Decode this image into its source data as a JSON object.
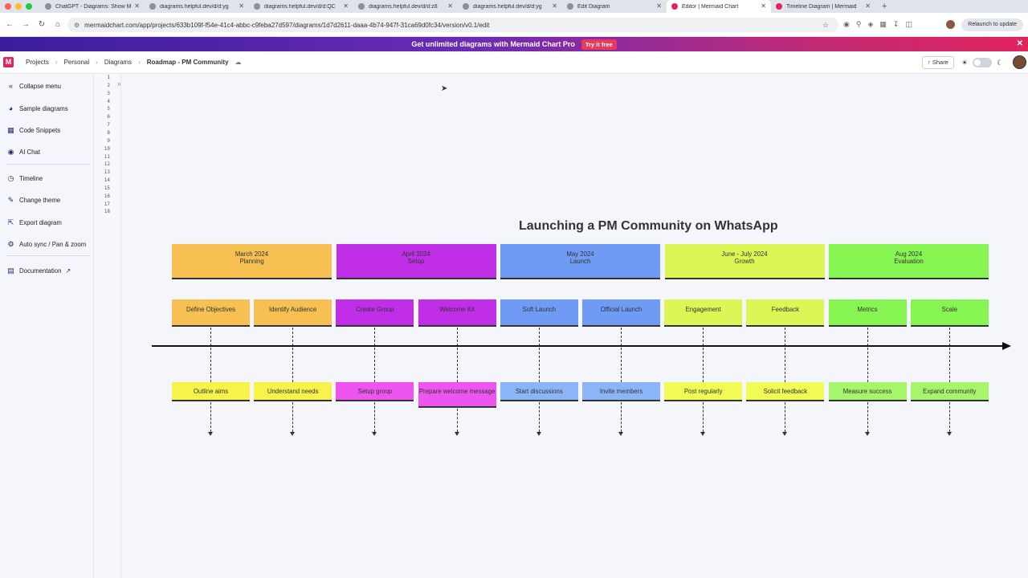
{
  "browser": {
    "tabs": [
      {
        "label": "ChatGPT - Diagrams: Show M",
        "active": false
      },
      {
        "label": "diagrams.helpful.dev/d/d:yg",
        "active": false
      },
      {
        "label": "diagrams.helpful.dev/d/d:QC",
        "active": false
      },
      {
        "label": "diagrams.helpful.dev/d/d:z8",
        "active": false
      },
      {
        "label": "diagrams.helpful.dev/d/d:yg",
        "active": false
      },
      {
        "label": "Edit Diagram",
        "active": false
      },
      {
        "label": "Editor | Mermaid Chart",
        "active": true
      },
      {
        "label": "Timeline Diagram | Mermaid",
        "active": false
      }
    ],
    "url": "mermaidchart.com/app/projects/633b109f-f54e-41c4-abbc-c9feba27d597/diagrams/1d7d2611-daaa-4b74-947f-31ca69d0fc34/version/v0.1/edit",
    "relaunch_label": "Relaunch to update"
  },
  "promo": {
    "text": "Get unlimited diagrams with Mermaid Chart Pro",
    "cta": "Try it free"
  },
  "header": {
    "logo": "M",
    "breadcrumbs": [
      "Projects",
      "Personal",
      "Diagrams",
      "Roadmap - PM Community"
    ],
    "share_label": "Share"
  },
  "sidebar": {
    "collapse": "Collapse menu",
    "items": [
      {
        "label": "Sample diagrams",
        "icon": "pie-chart-icon"
      },
      {
        "label": "Code Snippets",
        "icon": "grid-icon"
      },
      {
        "label": "AI Chat",
        "icon": "chat-icon"
      },
      {
        "label": "Timeline",
        "icon": "clock-icon"
      },
      {
        "label": "Change theme",
        "icon": "brush-icon"
      },
      {
        "label": "Export diagram",
        "icon": "export-icon"
      },
      {
        "label": "Auto sync / Pan & zoom",
        "icon": "gear-icon"
      },
      {
        "label": "Documentation",
        "icon": "book-icon"
      }
    ]
  },
  "editor": {
    "line_numbers": [
      "1",
      "2",
      "3",
      "4",
      "5",
      "6",
      "7",
      "8",
      "9",
      "10",
      "11",
      "12",
      "13",
      "14",
      "15",
      "16",
      "17",
      "18"
    ]
  },
  "diagram": {
    "title": "Launching a PM Community on WhatsApp",
    "periods": [
      {
        "date": "March 2024",
        "phase": "Planning",
        "color": "#f6c053"
      },
      {
        "date": "April 2024",
        "phase": "Setup",
        "color": "#c02ee8"
      },
      {
        "date": "May 2024",
        "phase": "Launch",
        "color": "#6f9bf5"
      },
      {
        "date": "June - July 2024",
        "phase": "Growth",
        "color": "#ddf655"
      },
      {
        "date": "Aug 2024",
        "phase": "Evaluation",
        "color": "#86f552"
      }
    ],
    "tasks": [
      "Define Objectives",
      "Identify Audience",
      "Create Group",
      "Welcome Kit",
      "Soft Launch",
      "Official Launch",
      "Engagement",
      "Feedback",
      "Metrics",
      "Scale"
    ],
    "events": [
      "Outline aims",
      "Understand needs",
      "Setup group",
      "Prepare welcome message",
      "Start discussions",
      "Invite members",
      "Post regularly",
      "Solicit feedback",
      "Measure success",
      "Expand community"
    ],
    "task_colors": [
      "#f6c053",
      "#f6c053",
      "#c02ee8",
      "#c02ee8",
      "#6f9bf5",
      "#6f9bf5",
      "#ddf655",
      "#ddf655",
      "#86f552",
      "#86f552"
    ],
    "event_colors": [
      "#f7f34a",
      "#f7f34a",
      "#ee55f0",
      "#ee55f0",
      "#8cb5f8",
      "#8cb5f8",
      "#f0fb56",
      "#f0fb56",
      "#a6f56a",
      "#a6f56a"
    ]
  }
}
